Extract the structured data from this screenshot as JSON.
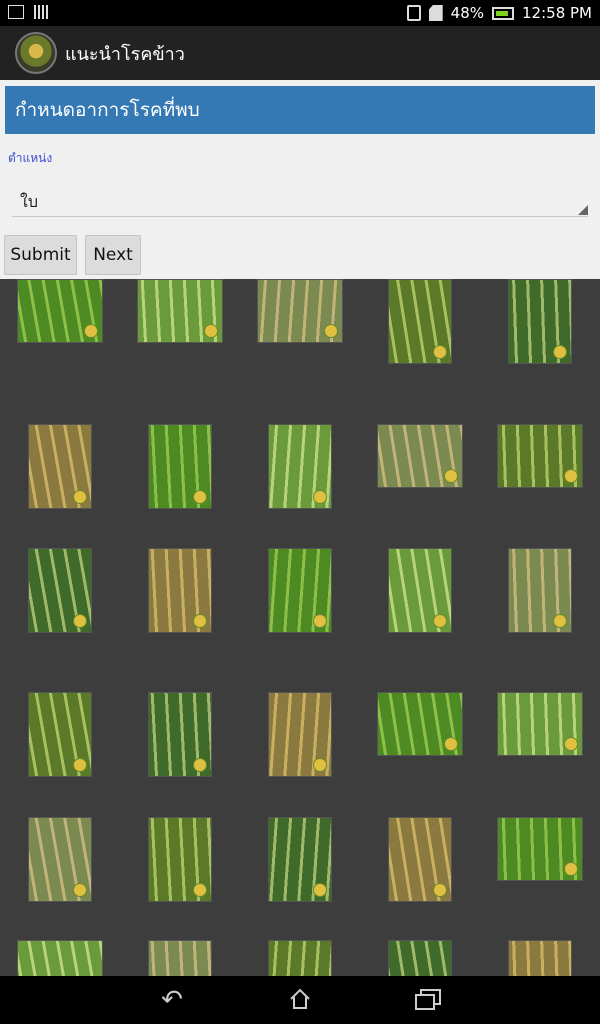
{
  "status_bar": {
    "battery": "48%",
    "time": "12:58 PM"
  },
  "app_bar": {
    "title": "แนะนำโรคข้าว",
    "logo_icon": "rice-disease-logo"
  },
  "form": {
    "header": "กำหนดอาการโรคที่พบ",
    "field_label": "ตำแหน่ง",
    "selected_value": "ใบ",
    "submit_label": "Submit",
    "next_label": "Next"
  },
  "colors": {
    "header_bg": "#3579b4",
    "field_label": "#3a4fd0",
    "grid_bg": "#3d3d3d"
  },
  "grid": {
    "columns": 5,
    "rows": 6
  }
}
